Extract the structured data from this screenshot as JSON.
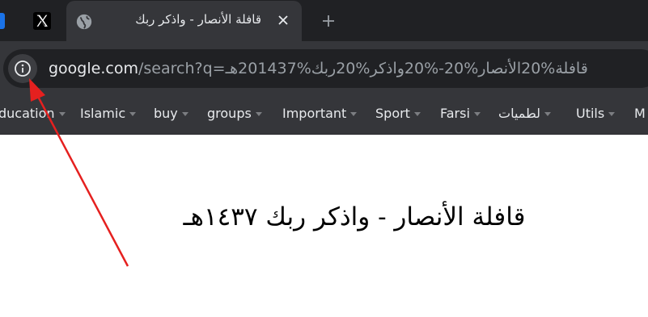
{
  "tabs": {
    "active_title": "قافلة الأنصار - واذكر ربك",
    "x_tab_icon": "x-logo-icon",
    "active_icon": "globe-icon",
    "close_icon": "close-icon",
    "new_tab_icon": "plus-icon"
  },
  "omnibox": {
    "info_icon": "info-icon",
    "url_host": "google.com",
    "url_rest": "/search?q=قافلة%20الأنصار%20-%20واذكر%20ربك%201437هـ"
  },
  "bookmarks": [
    {
      "label": "ducation"
    },
    {
      "label": "Islamic"
    },
    {
      "label": "buy"
    },
    {
      "label": "groups"
    },
    {
      "label": "Important"
    },
    {
      "label": "Sport"
    },
    {
      "label": "Farsi"
    },
    {
      "label": "لطميات"
    },
    {
      "label": "Utils"
    },
    {
      "label": "M"
    }
  ],
  "page": {
    "heading": "قافلة الأنصار - واذكر ربك ١٤٣٧هـ"
  },
  "annotation": {
    "arrow_color": "#e5201f"
  },
  "colors": {
    "tabstrip": "#202124",
    "toolbar": "#35363a",
    "text": "#e8eaed"
  }
}
